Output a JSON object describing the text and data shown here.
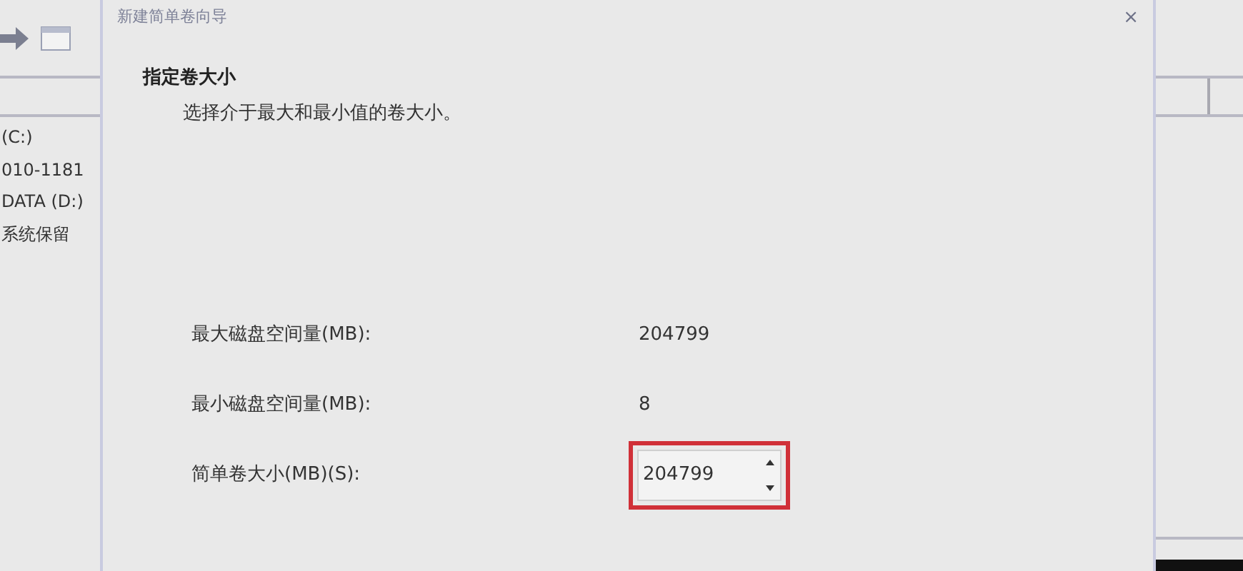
{
  "background": {
    "volumes": [
      {
        "label": "(C:)"
      },
      {
        "label": "010-1181"
      },
      {
        "label": "DATA (D:)"
      },
      {
        "label": "系统保留"
      }
    ]
  },
  "dialog": {
    "title": "新建简单卷向导",
    "close": "×",
    "heading": "指定卷大小",
    "description": "选择介于最大和最小值的卷大小。",
    "fields": [
      {
        "kind": "text",
        "label": "最大磁盘空间量(MB):",
        "value": "204799"
      },
      {
        "kind": "text",
        "label": "最小磁盘空间量(MB):",
        "value": "8"
      },
      {
        "kind": "spin",
        "label": "简单卷大小(MB)(S):",
        "value": "204799",
        "highlighted": true
      }
    ]
  }
}
